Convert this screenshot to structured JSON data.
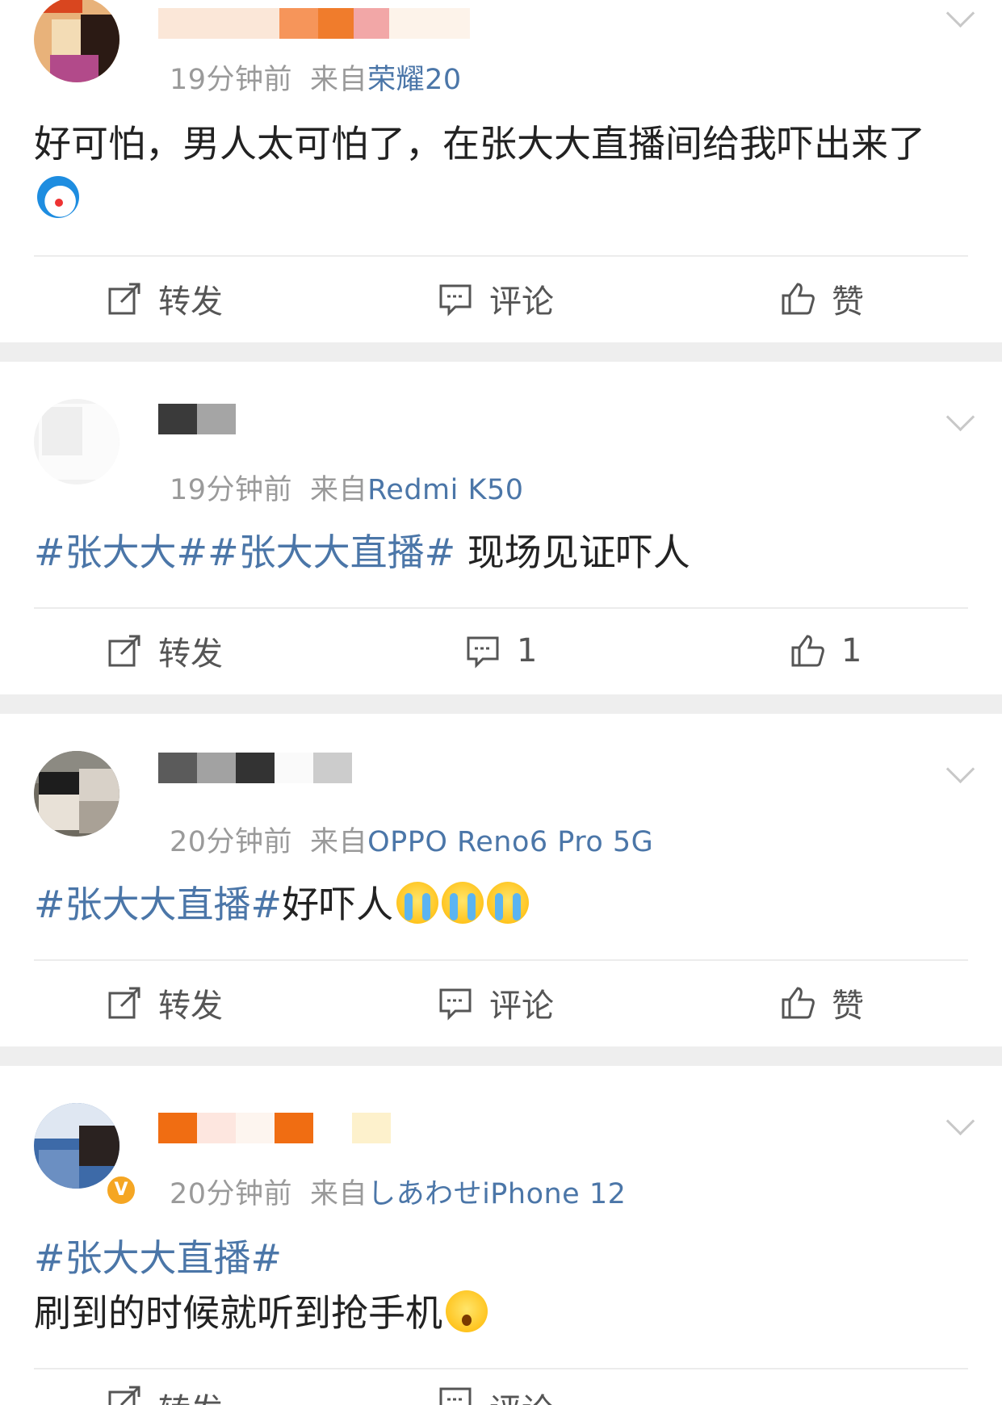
{
  "colors": {
    "topic_link": "#4b76a8",
    "meta_gray": "#9a9a9a",
    "separator": "#eeeeee",
    "verified_badge": "#f5a623"
  },
  "posts": [
    {
      "time": "19分钟前",
      "from_label": "来自",
      "source": "荣耀20",
      "content_plain": "好可怕，男人太可怕了，在张大大直播间给我吓出来了",
      "emoji": [
        "doraemon-emoji"
      ],
      "actions": {
        "repost": "转发",
        "comment": "评论",
        "like": "赞"
      }
    },
    {
      "time": "19分钟前",
      "from_label": "来自",
      "source": "Redmi K50",
      "topics": [
        "#张大大#",
        "#张大大直播#"
      ],
      "content_plain": " 现场见证吓人",
      "actions": {
        "repost": "转发",
        "comment": "1",
        "like": "1"
      }
    },
    {
      "time": "20分钟前",
      "from_label": "来自",
      "source": "OPPO Reno6 Pro 5G",
      "topics": [
        "#张大大直播#"
      ],
      "content_plain": "好吓人",
      "emoji": [
        "crying-emoji",
        "crying-emoji",
        "crying-emoji"
      ],
      "actions": {
        "repost": "转发",
        "comment": "评论",
        "like": "赞"
      }
    },
    {
      "time": "20分钟前",
      "from_label": "来自",
      "source": "しあわせiPhone 12",
      "topics": [
        "#张大大直播#"
      ],
      "content_plain": "刷到的时候就听到抢手机",
      "emoji": [
        "shocked-emoji"
      ],
      "verified_badge": "V",
      "actions": {
        "repost": "转发",
        "comment": "评论"
      }
    }
  ]
}
